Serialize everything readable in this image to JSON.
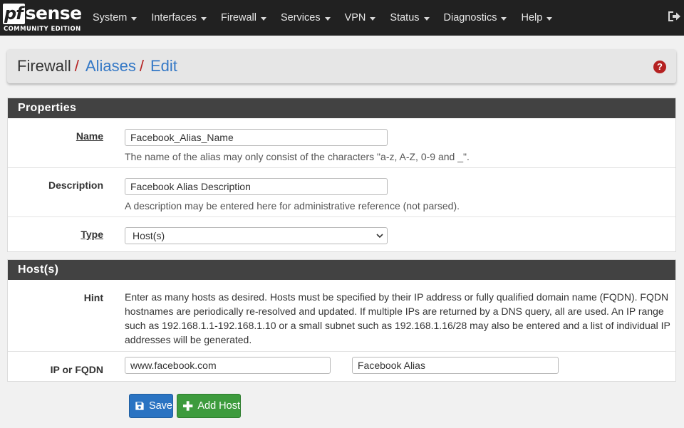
{
  "brand": {
    "logo_pf": "pf",
    "logo_sense": "sense",
    "edition": "COMMUNITY EDITION"
  },
  "menu": [
    "System",
    "Interfaces",
    "Firewall",
    "Services",
    "VPN",
    "Status",
    "Diagnostics",
    "Help"
  ],
  "breadcrumb": {
    "section": "Firewall",
    "separator": "/",
    "page": "Aliases",
    "action": "Edit",
    "help": "?"
  },
  "properties": {
    "heading": "Properties",
    "name_label": "Name",
    "name_value": "Facebook_Alias_Name",
    "name_help": "The name of the alias may only consist of the characters \"a-z, A-Z, 0-9 and _\".",
    "description_label": "Description",
    "description_value": "Facebook Alias Description",
    "description_help": "A description may be entered here for administrative reference (not parsed).",
    "type_label": "Type",
    "type_value": "Host(s)"
  },
  "hosts": {
    "heading": "Host(s)",
    "hint_label": "Hint",
    "hint_text": "Enter as many hosts as desired. Hosts must be specified by their IP address or fully qualified domain name (FQDN). FQDN hostnames are periodically re-resolved and updated. If multiple IPs are returned by a DNS query, all are used. An IP range such as 192.168.1.1-192.168.1.10 or a small subnet such as 192.168.1.16/28 may also be entered and a list of individual IP addresses will be generated.",
    "ip_label": "IP or FQDN",
    "ip_value": "www.facebook.com",
    "ip_description": "Facebook Alias"
  },
  "buttons": {
    "save": "Save",
    "add_host": "Add Host"
  },
  "colors": {
    "navbar": "#212121",
    "accent_red": "#b52121",
    "link_blue": "#3478c6",
    "save_blue": "#2a73c2",
    "add_green": "#3d9b3d",
    "panel_heading": "#424242"
  }
}
